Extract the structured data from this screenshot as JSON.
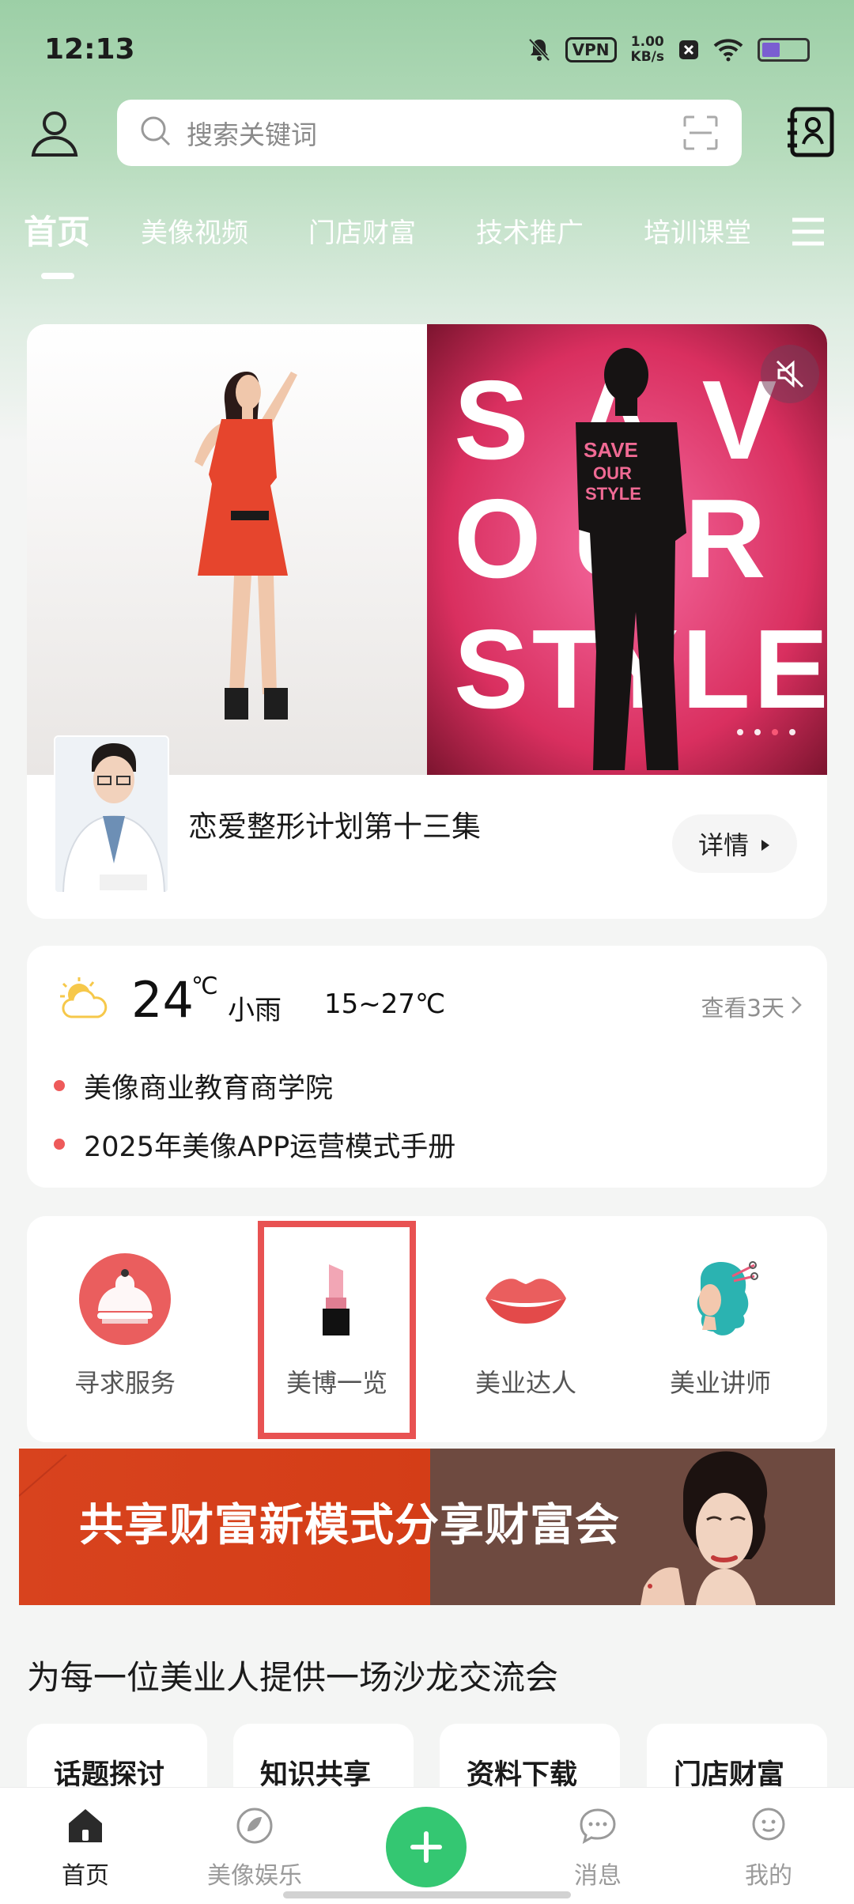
{
  "status_bar": {
    "time": "12:13",
    "vpn": "VPN",
    "speed_value": "1.00",
    "speed_unit": "KB/s"
  },
  "search": {
    "placeholder": "搜索关键词"
  },
  "tabs": [
    "首页",
    "美像视频",
    "门店财富",
    "技术推广",
    "培训课堂"
  ],
  "banner": {
    "poster_text": [
      "SAVE",
      "OUR",
      "STYLE"
    ],
    "episode_title": "恋爱整形计划第十三集",
    "detail_button": "详情",
    "dots": 4,
    "active_dot": 2
  },
  "weather": {
    "temperature": "24",
    "unit": "℃",
    "condition": "小雨",
    "range": "15~27℃",
    "forecast_link": "查看3天"
  },
  "news": [
    "美像商业教育商学院",
    "2025年美像APP运营模式手册"
  ],
  "shortcuts": [
    {
      "label": "寻求服务",
      "icon": "service-bell-icon"
    },
    {
      "label": "美博一览",
      "icon": "lipstick-icon"
    },
    {
      "label": "美业达人",
      "icon": "lips-icon"
    },
    {
      "label": "美业讲师",
      "icon": "hair-stylist-icon"
    }
  ],
  "promo": {
    "text": "共享财富新模式分享财富会"
  },
  "section": {
    "title": "为每一位美业人提供一场沙龙交流会",
    "chips": [
      "话题探讨",
      "知识共享",
      "资料下载",
      "门店财富"
    ]
  },
  "bottom_nav": {
    "items": [
      {
        "label": "首页",
        "icon": "home-icon"
      },
      {
        "label": "美像娱乐",
        "icon": "entertainment-icon"
      },
      {
        "label": "消息",
        "icon": "message-icon"
      },
      {
        "label": "我的",
        "icon": "profile-icon"
      }
    ]
  },
  "colors": {
    "accent_green": "#34c772",
    "alert_red": "#e85252",
    "news_dot": "#ee5a5a"
  }
}
